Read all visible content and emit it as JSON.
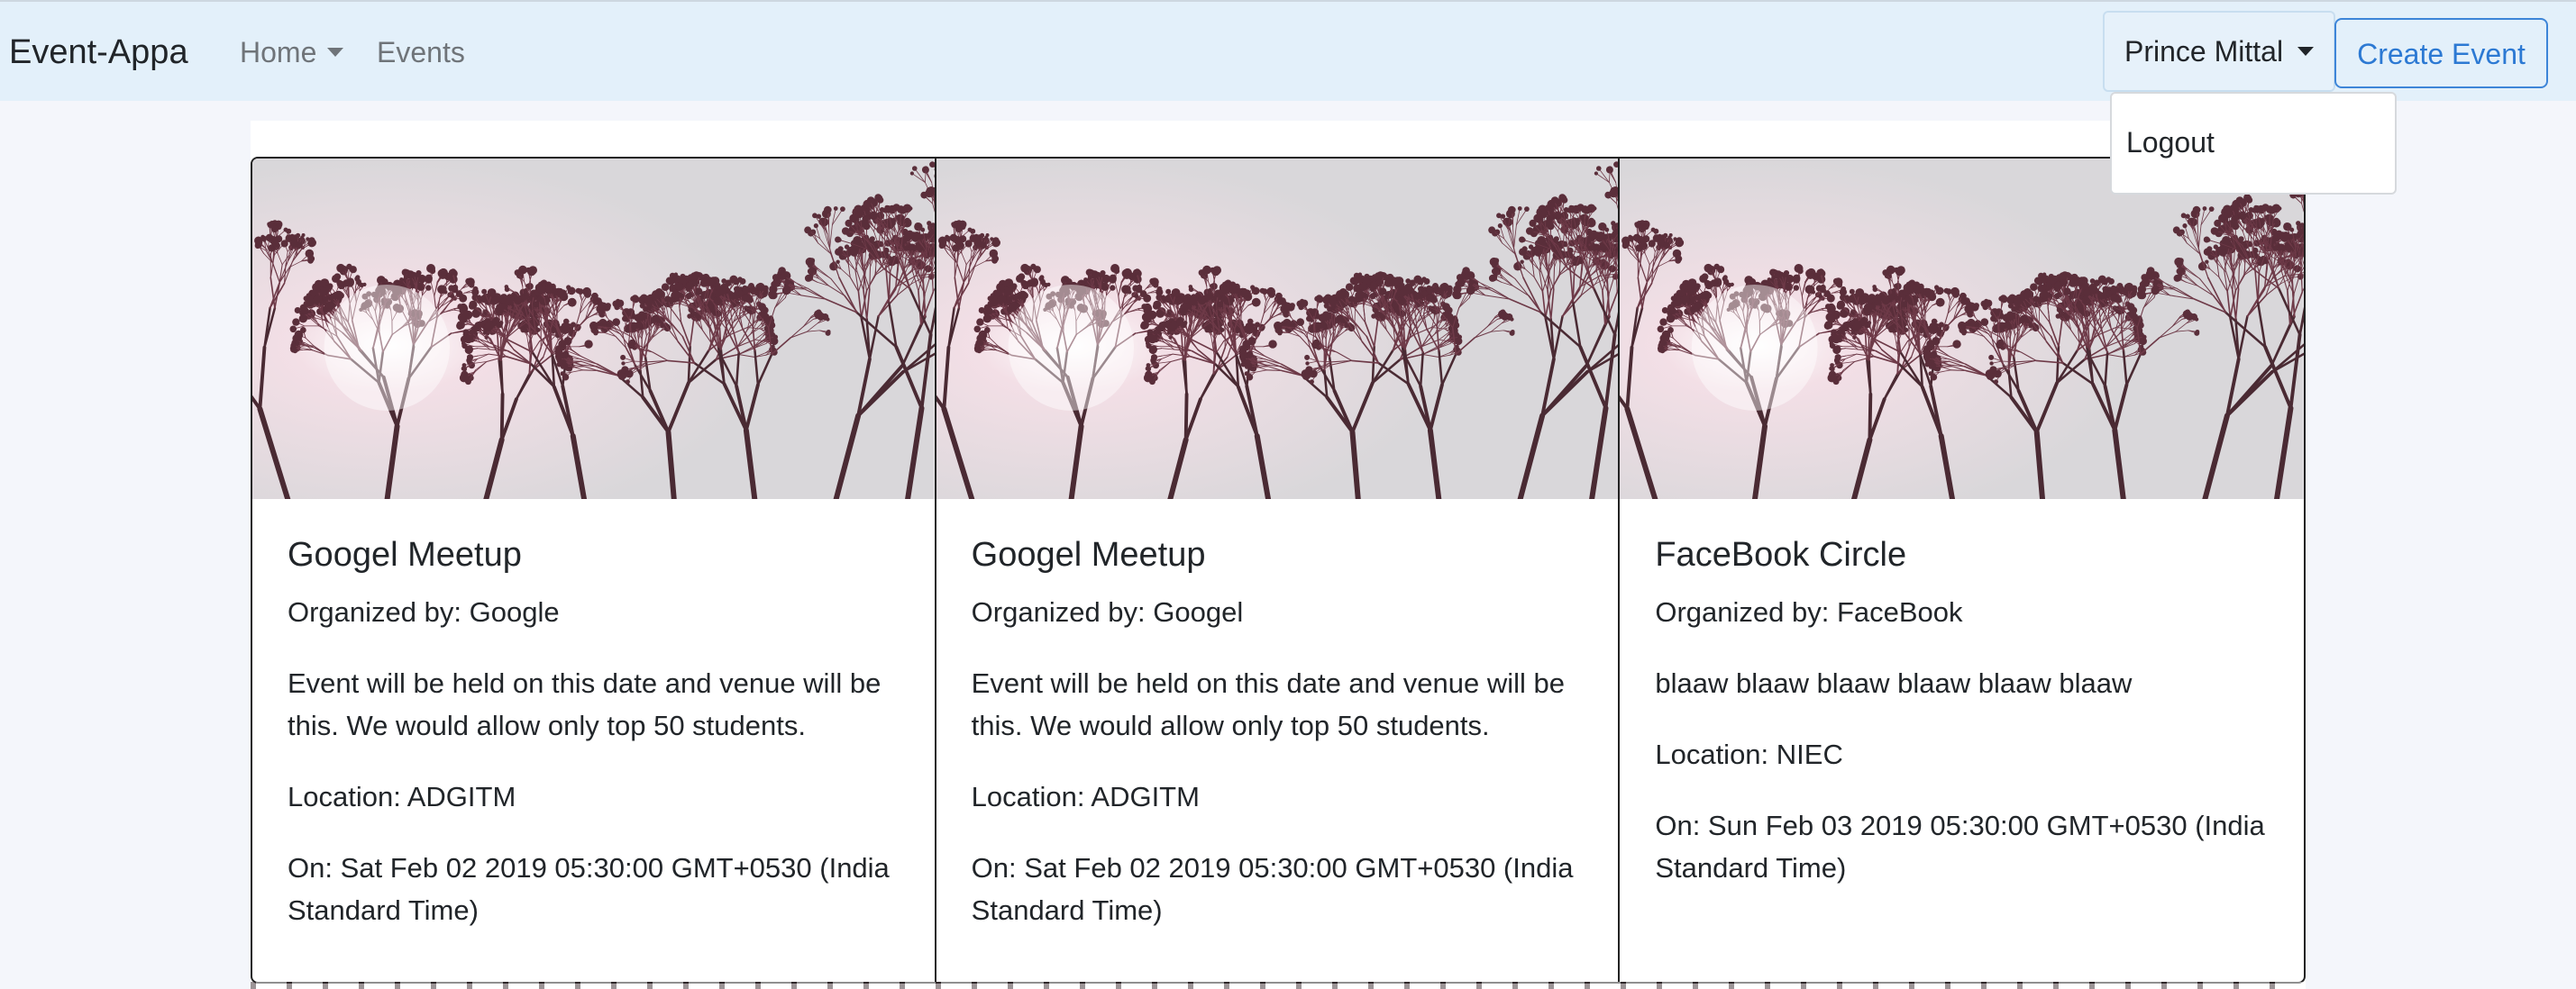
{
  "navbar": {
    "brand": "Event-Appa",
    "home": "Home",
    "events": "Events",
    "user": "Prince Mittal",
    "create_event": "Create Event"
  },
  "dropdown": {
    "logout": "Logout"
  },
  "colors": {
    "navbar_bg": "#e3f0fa",
    "create_event_accent": "#2c79d3"
  },
  "events": [
    {
      "image": "tree-branches-sunlight-image",
      "title": "Googel Meetup",
      "organizer": "Organized by: Google",
      "description": "Event will be held on this date and venue will be this. We would allow only top 50 students.",
      "location": "Location: ADGITM",
      "date": "On: Sat Feb 02 2019 05:30:00 GMT+0530 (India Standard Time)"
    },
    {
      "image": "tree-branches-sunlight-image",
      "title": "Googel Meetup",
      "organizer": "Organized by: Googel",
      "description": "Event will be held on this date and venue will be this. We would allow only top 50 students.",
      "location": "Location: ADGITM",
      "date": "On: Sat Feb 02 2019 05:30:00 GMT+0530 (India Standard Time)"
    },
    {
      "image": "tree-branches-sunlight-image",
      "title": "FaceBook Circle",
      "organizer": "Organized by: FaceBook",
      "description": "blaaw blaaw blaaw blaaw blaaw blaaw",
      "location": "Location: NIEC",
      "date": "On: Sun Feb 03 2019 05:30:00 GMT+0530 (India Standard Time)"
    }
  ]
}
